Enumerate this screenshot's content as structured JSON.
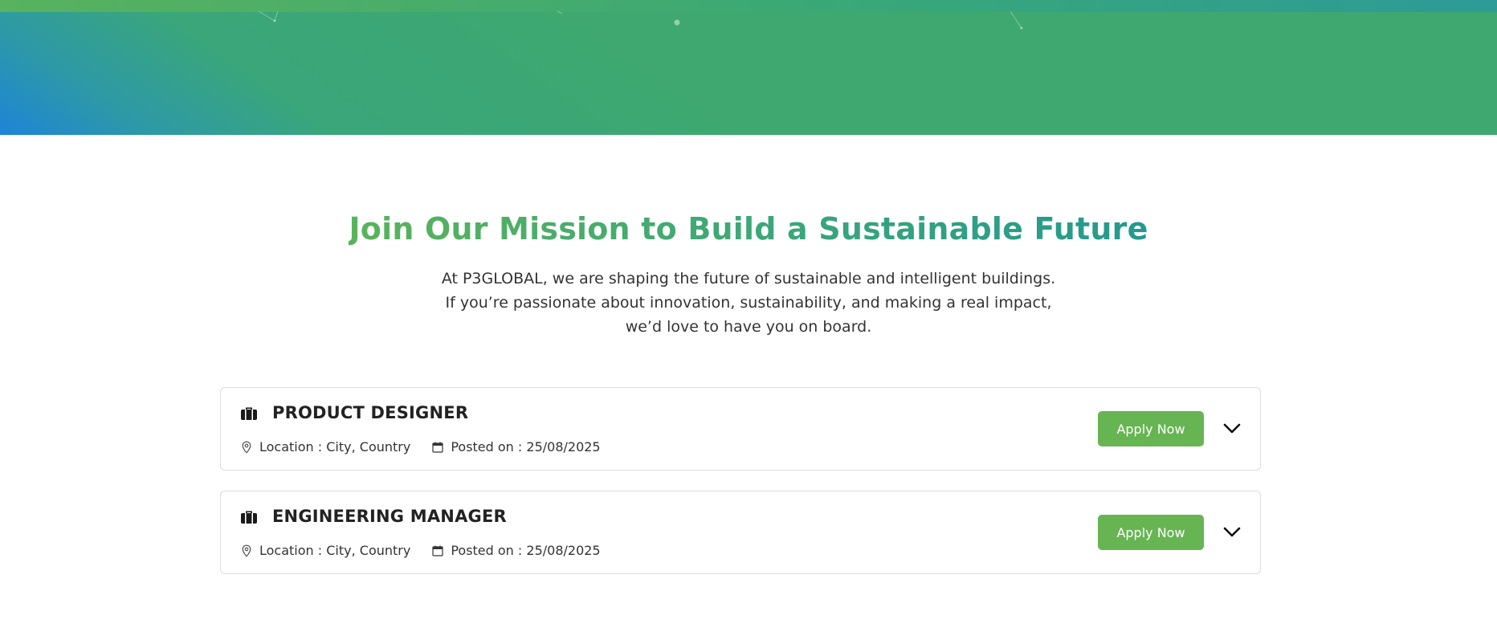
{
  "colors": {
    "brand_green": "#66b552",
    "hero_blue": "#1e84d8",
    "hero_green": "#3ea870",
    "title_gradient_start": "#5ab35b",
    "title_gradient_end": "#24998f"
  },
  "intro": {
    "title": "Join Our Mission to Build a Sustainable Future",
    "description": "At P3GLOBAL, we are shaping the future of sustainable and intelligent buildings. If you’re passionate about innovation, sustainability, and making a real impact, we’d love to have you on board."
  },
  "jobs": [
    {
      "title": "PRODUCT DESIGNER",
      "location": "Location : City, Country",
      "posted": "Posted on : 25/08/2025",
      "apply_label": "Apply Now",
      "icon": "briefcase-icon"
    },
    {
      "title": "ENGINEERING MANAGER",
      "location": "Location : City, Country",
      "posted": "Posted on : 25/08/2025",
      "apply_label": "Apply Now",
      "icon": "briefcase-icon"
    }
  ]
}
